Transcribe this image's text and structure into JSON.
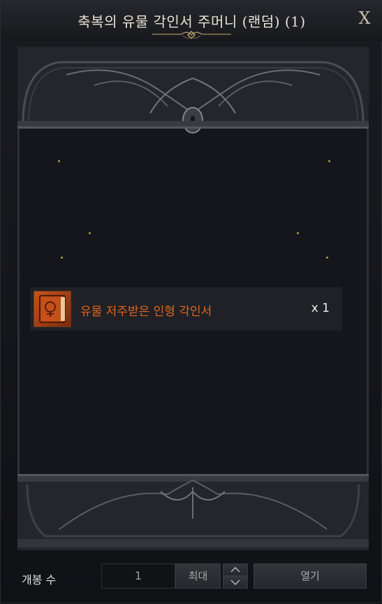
{
  "window": {
    "title": "축복의 유물 각인서 주머니 (랜덤) (1)",
    "close_label": "X"
  },
  "items": [
    {
      "name": "유물 저주받은 인형 각인서",
      "quantity": "x 1",
      "icon": "engraving-book-icon",
      "name_color": "#e0641f"
    }
  ],
  "footer": {
    "count_label": "개봉 수",
    "count_value": "1",
    "max_label": "최대",
    "open_label": "열기"
  }
}
